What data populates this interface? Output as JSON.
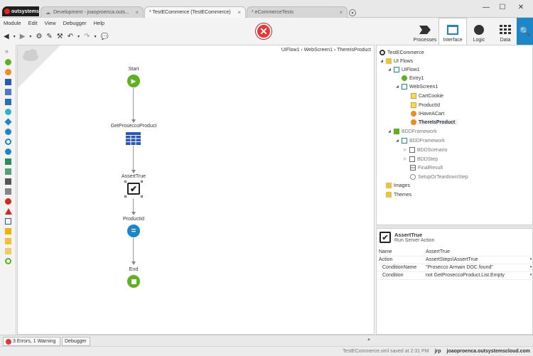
{
  "titlebar": {
    "logo": "outsystems",
    "tabs": [
      {
        "label": "Development - joaoproenca.outs...",
        "active": false
      },
      {
        "label": "* TestECommerce (TestECommerce)",
        "active": true
      },
      {
        "label": "* eCommerceTests",
        "active": false
      }
    ],
    "close_glyph": "×",
    "new_tab_glyph": "▾",
    "window_buttons": {
      "minimize": "—",
      "maximize": "☐",
      "close": "✕"
    }
  },
  "menu": [
    "Module",
    "Edit",
    "View",
    "Debugger",
    "Help"
  ],
  "toolbar_glyphs": {
    "back": "◀",
    "forward": "▶",
    "dropdown": "▾",
    "settings": "⚙",
    "debug": "✎",
    "compare": "⚒",
    "undo": "↶",
    "redo": "↷",
    "comments": "💬",
    "error": "✕"
  },
  "layers": [
    {
      "label": "Processes",
      "active": false
    },
    {
      "label": "Interface",
      "active": true
    },
    {
      "label": "Logic",
      "active": false
    },
    {
      "label": "Data",
      "active": false
    }
  ],
  "search_glyph": "🔍",
  "palette_expand_glyph": "»",
  "canvas": {
    "breadcrumb": "UIFlow1 › WebScreen1 › ThereIsProduct",
    "nodes": {
      "start": "Start",
      "aggregate": "GetProseccoProduct",
      "assert": "AssertTrue",
      "assign": "ProductId",
      "end": "End"
    },
    "node_glyphs": {
      "start": "▶",
      "assert": "✔",
      "assign": "="
    }
  },
  "tree": {
    "root": "TestECommerce",
    "ui_flows": "UI Flows",
    "uiflow1": "UIFlow1",
    "entry1": "Entry1",
    "webscreen1": "WebScreen1",
    "cartcookie": "CartCookie",
    "productid": "ProductId",
    "ihaveacart": "IHaveACart",
    "thereisproduct": "ThereIsProduct",
    "bddframework_ref": "BDDFramework",
    "bddframework": "BDDFramework",
    "bddscenario": "BDDScenario",
    "bddstep": "BDDStep",
    "finalresult": "FinalResult",
    "setup": "SetupOrTeardownStep",
    "images": "Images",
    "themes": "Themes",
    "twisty_open": "◢",
    "twisty_closed": "▷",
    "result_glyph": "RES"
  },
  "properties": {
    "title": "AssertTrue",
    "subtitle": "Run Server Action",
    "header_glyph": "✔",
    "dropdown_glyph": "▾",
    "rows": [
      {
        "key": "Name",
        "value": "AssertTrue",
        "dropdown": false
      },
      {
        "key": "Action",
        "value": "AssertSteps\\AssertTrue",
        "dropdown": true
      },
      {
        "key": "ConditionName",
        "value": "\"Prosecco Armain DOC found\"",
        "dropdown": true
      },
      {
        "key": "Condition",
        "value": "not GetProseccoProduct.List.Empty",
        "dropdown": true
      }
    ]
  },
  "bottom": {
    "errors_tab": "3 Errors, 1 Warning",
    "debugger_tab": "Debugger",
    "collapse_glyph": "▲"
  },
  "status": {
    "saved": "TestECommerce.oml saved at 2:31 PM",
    "user": "jrp",
    "server": "joaoproenca.outsystemscloud.com"
  }
}
